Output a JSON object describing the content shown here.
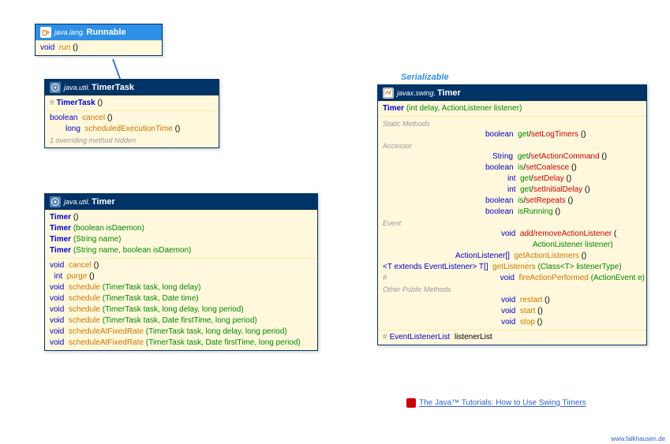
{
  "runnable": {
    "pkg": "java.lang.",
    "name": "Runnable",
    "run_ret": "void",
    "run": "run",
    "run_parens": "()"
  },
  "timerTask": {
    "pkg": "java.util.",
    "name": "TimerTask",
    "ctor": "TimerTask",
    "ctor_parens": "()",
    "cancel_ret": "boolean",
    "cancel": "cancel",
    "cancel_parens": "()",
    "sched_ret": "long",
    "sched": "scheduledExecutionTime",
    "sched_parens": "()",
    "hidden": "1 overriding method hidden",
    "hash": "#"
  },
  "utilTimer": {
    "pkg": "java.util.",
    "name": "Timer",
    "c1": "Timer",
    "c1p": "()",
    "c2": "Timer",
    "c2p": "(boolean isDaemon)",
    "c3": "Timer",
    "c3p": "(String name)",
    "c4": "Timer",
    "c4p": "(String name, boolean isDaemon)",
    "m1_ret": "void",
    "m1": "cancel",
    "m1p": "()",
    "m2_ret": "int",
    "m2": "purge",
    "m2p": "()",
    "m3_ret": "void",
    "m3": "schedule",
    "m3p": "(TimerTask task, long delay)",
    "m4_ret": "void",
    "m4": "schedule",
    "m4p": "(TimerTask task, Date time)",
    "m5_ret": "void",
    "m5": "schedule",
    "m5p": "(TimerTask task, long delay, long period)",
    "m6_ret": "void",
    "m6": "schedule",
    "m6p": "(TimerTask task, Date firstTime, long period)",
    "m7_ret": "void",
    "m7": "scheduleAtFixedRate",
    "m7p": "(TimerTask task, long delay, long period)",
    "m8_ret": "void",
    "m8": "scheduleAtFixedRate",
    "m8p": "(TimerTask task, Date firstTime, long period)"
  },
  "serial": "Serializable",
  "swingTimer": {
    "pkg": "javax.swing.",
    "name": "Timer",
    "ctor": "Timer",
    "ctorp": "(int delay, ActionListener listener)",
    "static_lbl": "Static Methods",
    "acc_lbl": "Accessor",
    "evt_lbl": "Event",
    "other_lbl": "Other Public Methods",
    "log_ret": "boolean",
    "log_g": "get",
    "log_s": "setLogTimers",
    "log_parens": "()",
    "ac_ret": "String",
    "ac_g": "get",
    "ac_s": "setActionCommand",
    "ac_parens": "()",
    "coal_ret": "boolean",
    "coal_g": "is",
    "coal_s": "setCoalesce",
    "coal_parens": "()",
    "del_ret": "int",
    "del_g": "get",
    "del_s": "setDelay",
    "del_parens": "()",
    "init_ret": "int",
    "init_g": "get",
    "init_s": "setInitialDelay",
    "init_parens": "()",
    "rep_ret": "boolean",
    "rep_g": "is",
    "rep_s": "setRepeats",
    "rep_parens": "()",
    "run_ret": "boolean",
    "run": "isRunning",
    "run_parens": "()",
    "al_ret": "void",
    "al_m": "add/removeActionListener",
    "al_p": "(",
    "al_p2": "ActionListener listener)",
    "gl_ret": "ActionListener[]",
    "gl": "getActionListeners",
    "gl_parens": "()",
    "lst_pre": "<T extends EventListener> T[]",
    "lst": "getListeners",
    "lst_p": "(Class<T> listenerType)",
    "fap_ret": "void",
    "fap": "fireActionPerformed",
    "fap_p": "(ActionEvent e)",
    "hash": "#",
    "rst_ret": "void",
    "rst": "restart",
    "rst_parens": "()",
    "st_ret": "void",
    "st": "start",
    "st_parens": "()",
    "sp_ret": "void",
    "sp": "stop",
    "sp_parens": "()",
    "ell_type": "EventListenerList",
    "ell_name": "listenerList",
    "ell_hash": "#"
  },
  "tutorial": "The Java™ Tutorials: How to Use Swing Timers",
  "attrib": "www.falkhausen.de"
}
